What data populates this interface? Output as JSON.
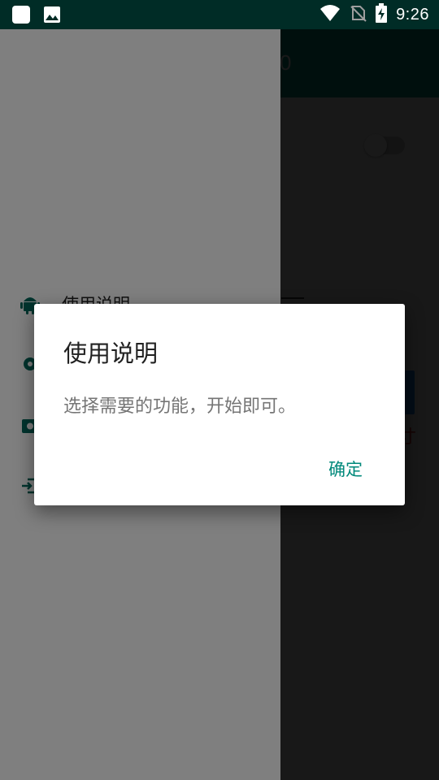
{
  "status_bar": {
    "time": "9:26",
    "left_icons": [
      "app-notification-icon",
      "image-notification-icon"
    ],
    "right_icons": [
      "wifi-icon",
      "no-sim-icon",
      "battery-charging-icon"
    ]
  },
  "background_app": {
    "toolbar_title_fragment": "0",
    "red_text_fragment": "寸"
  },
  "drawer": {
    "items": [
      {
        "label": "使用说明",
        "icon": "android-icon"
      },
      {
        "label": "",
        "icon": "gear-icon"
      },
      {
        "label": "",
        "icon": "screenshot-icon"
      },
      {
        "label": "",
        "icon": "exit-icon"
      }
    ]
  },
  "dialog": {
    "title": "使用说明",
    "message": "选择需要的功能，开始即可。",
    "confirm_label": "确定"
  },
  "colors": {
    "primary": "#009688",
    "primary_dark": "#002c26",
    "accent": "#00897b",
    "dim_background": "#333333"
  }
}
